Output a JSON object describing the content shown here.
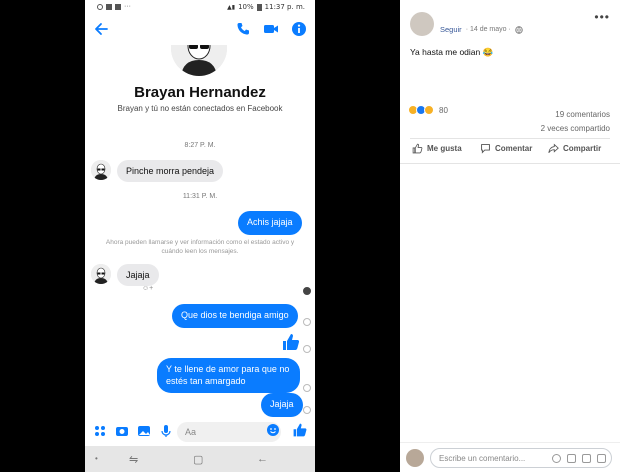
{
  "status": {
    "time": "11:37 p. m.",
    "battery": "10%"
  },
  "header": {
    "back": "back-arrow-icon",
    "actions": [
      "phone-icon",
      "video-icon",
      "info-icon"
    ]
  },
  "profile": {
    "name": "Brayan Hernandez",
    "subtitle": "Brayan y tú no están conectados en Facebook"
  },
  "conversation": {
    "time1": "8:27 P. M.",
    "msg_in_1": "Pinche morra pendeja",
    "time2": "11:31 P. M.",
    "msg_out_1": "Achis jajaja",
    "info": "Ahora pueden llamarse y ver información como el estado activo y cuándo leen los mensajes.",
    "msg_in_2": "Jajaja",
    "msg_out_2": "Que dios te bendiga amigo",
    "msg_out_3": "Y te llene de amor para que no estés tan amargado",
    "msg_out_4": "Jajaja"
  },
  "composer": {
    "placeholder": "Aa"
  },
  "colors": {
    "messenger_blue": "#0a7cff",
    "fb_blue": "#385898"
  },
  "post": {
    "follow": "Seguir",
    "date": "· 14 de mayo ·",
    "text": "Ya hasta me odian 😂",
    "reaction_count": "80",
    "comments": "19 comentarios",
    "shares": "2 veces compartido",
    "like": "Me gusta",
    "comment": "Comentar",
    "share": "Compartir",
    "comment_placeholder": "Escribe un comentario..."
  }
}
